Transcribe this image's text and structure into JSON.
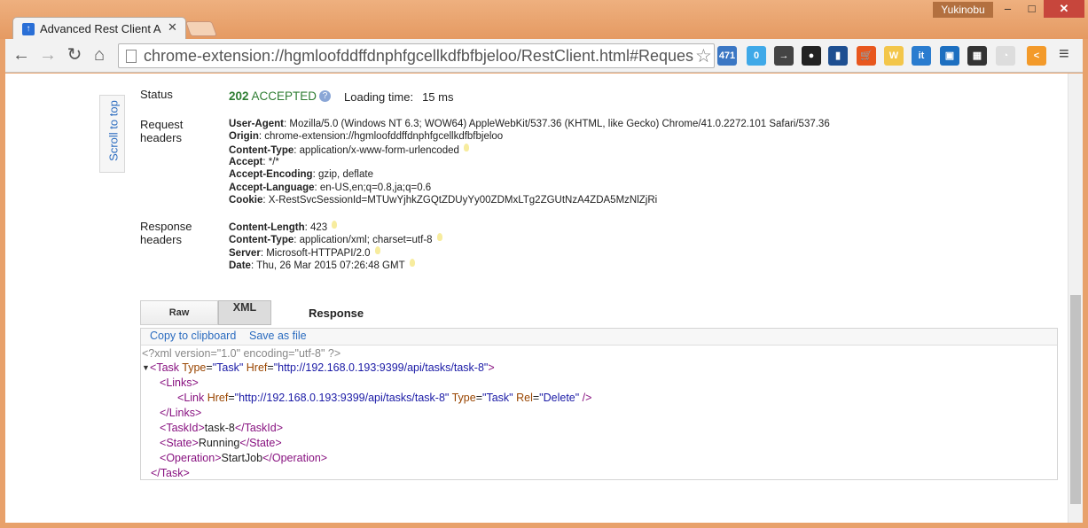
{
  "window": {
    "user": "Yukinobu",
    "min_label": "–",
    "max_label": "□",
    "close_label": "✕"
  },
  "tab": {
    "title": "Advanced Rest Client A",
    "close_label": "✕",
    "favicon": "arc-favicon-icon"
  },
  "toolbar": {
    "url": "chrome-extension://hgmloofddffdnphfgcellkdfbfbjeloo/RestClient.html#Reques",
    "back_label": "←",
    "forward_label": "→",
    "reload_label": "↻",
    "home_label": "⌂",
    "star_label": "☆",
    "menu_label": "≡",
    "extensions": [
      {
        "icon": "extension-471-icon",
        "label": "471",
        "color": "#3b77c4"
      },
      {
        "icon": "twitter-extension-icon",
        "label": "0",
        "color": "#3fa9e8"
      },
      {
        "icon": "phone-sync-icon",
        "label": "→",
        "color": "#444444"
      },
      {
        "icon": "color-wheel-icon",
        "label": "●",
        "color": "#222222"
      },
      {
        "icon": "analytics-bars-icon",
        "label": "▮",
        "color": "#1e4f91"
      },
      {
        "icon": "cart-icon",
        "label": "🛒",
        "color": "#e8571e"
      },
      {
        "icon": "w-extension-icon",
        "label": "W",
        "color": "#f3c64a"
      },
      {
        "icon": "it-extension-icon",
        "label": "it",
        "color": "#2a7ccf"
      },
      {
        "icon": "window-extension-icon",
        "label": "▣",
        "color": "#1d6fc0"
      },
      {
        "icon": "film-extension-icon",
        "label": "▦",
        "color": "#333333"
      },
      {
        "icon": "clock-extension-icon",
        "label": "◔",
        "color": "#dddddd"
      },
      {
        "icon": "share-extension-icon",
        "label": "<",
        "color": "#f39a2a"
      }
    ]
  },
  "sidebar": {
    "scroll_to_top": "Scroll to top"
  },
  "status": {
    "label": "Status",
    "code": "202",
    "text": "ACCEPTED",
    "loading_label": "Loading time:",
    "loading_value": "15 ms"
  },
  "request_headers": {
    "label_line1": "Request",
    "label_line2": "headers",
    "items": [
      {
        "name": "User-Agent",
        "value": ": Mozilla/5.0 (Windows NT 6.3; WOW64) AppleWebKit/537.36 (KHTML, like Gecko) Chrome/41.0.2272.101 Safari/537.36",
        "hint": false
      },
      {
        "name": "Origin",
        "value": ": chrome-extension://hgmloofddffdnphfgcellkdfbfbjeloo",
        "hint": false
      },
      {
        "name": "Content-Type",
        "value": ": application/x-www-form-urlencoded",
        "hint": true
      },
      {
        "name": "Accept",
        "value": ": */*",
        "hint": false
      },
      {
        "name": "Accept-Encoding",
        "value": ": gzip, deflate",
        "hint": false
      },
      {
        "name": "Accept-Language",
        "value": ": en-US,en;q=0.8,ja;q=0.6",
        "hint": false
      },
      {
        "name": "Cookie",
        "value": ": X-RestSvcSessionId=MTUwYjhkZGQtZDUyYy00ZDMxLTg2ZGUtNzA4ZDA5MzNlZjRi",
        "hint": false
      }
    ]
  },
  "response_headers": {
    "label_line1": "Response",
    "label_line2": "headers",
    "items": [
      {
        "name": "Content-Length",
        "value": ": 423",
        "hint": true
      },
      {
        "name": "Content-Type",
        "value": ": application/xml; charset=utf-8",
        "hint": true
      },
      {
        "name": "Server",
        "value": ": Microsoft-HTTPAPI/2.0",
        "hint": true
      },
      {
        "name": "Date",
        "value": ": Thu, 26 Mar 2015 07:26:48 GMT",
        "hint": true
      }
    ]
  },
  "response": {
    "tab_raw": "Raw",
    "tab_xml": "XML",
    "title": "Response",
    "copy_label": "Copy to clipboard",
    "save_label": "Save as file",
    "xml": {
      "declaration": "<?xml version=\"1.0\" encoding=\"utf-8\" ?>",
      "task_tag": "Task",
      "task_type_attr": "Type",
      "task_type_val": "\"Task\"",
      "task_href_attr": "Href",
      "task_href_val": "\"http://192.168.0.193:9399/api/tasks/task-8\"",
      "links_tag": "Links",
      "link_tag": "Link",
      "link_href_attr": "Href",
      "link_href_val": "\"http://192.168.0.193:9399/api/tasks/task-8\"",
      "link_type_attr": "Type",
      "link_type_val": "\"Task\"",
      "link_rel_attr": "Rel",
      "link_rel_val": "\"Delete\"",
      "taskid_tag": "TaskId",
      "taskid_val": "task-8",
      "state_tag": "State",
      "state_val": "Running",
      "operation_tag": "Operation",
      "operation_val": "StartJob"
    }
  }
}
